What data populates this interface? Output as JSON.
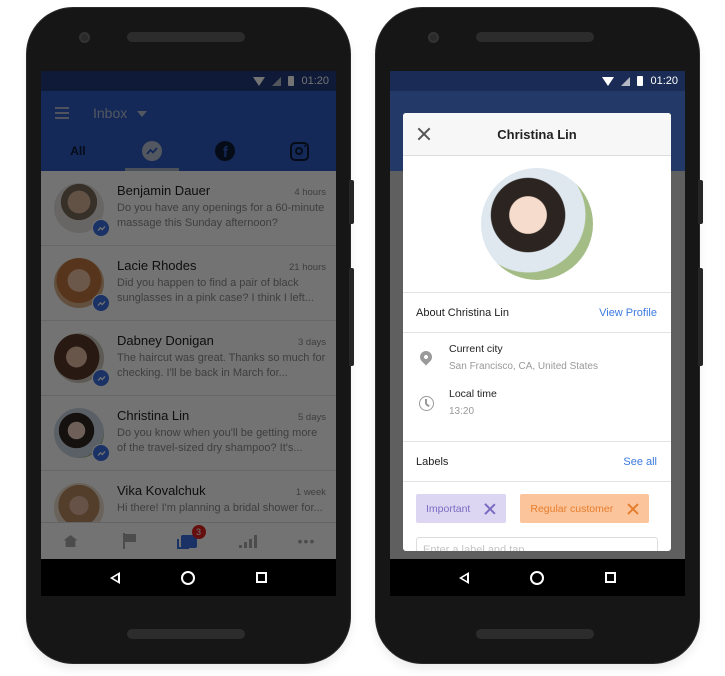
{
  "status_bar": {
    "time": "01:20"
  },
  "left_phone": {
    "app_bar": {
      "title": "Inbox",
      "tabs": [
        {
          "label": "All",
          "icon": ""
        },
        {
          "label": "",
          "icon": "messenger-icon",
          "active": true
        },
        {
          "label": "",
          "icon": "facebook-icon"
        },
        {
          "label": "",
          "icon": "instagram-icon"
        }
      ]
    },
    "conversations": [
      {
        "name": "Benjamin Dauer",
        "time": "4 hours",
        "preview": "Do you have any openings for a 60-minute massage this Sunday afternoon?",
        "source_icon": "messenger-icon"
      },
      {
        "name": "Lacie Rhodes",
        "time": "21 hours",
        "preview": "Did you happen to find a pair of black sunglasses in a pink case? I think I left...",
        "source_icon": "messenger-icon"
      },
      {
        "name": "Dabney Donigan",
        "time": "3 days",
        "preview": "The haircut was great. Thanks so much for checking. I'll be back in March for...",
        "source_icon": "messenger-icon"
      },
      {
        "name": "Christina Lin",
        "time": "5 days",
        "preview": "Do you know when you'll be getting more of the travel-sized dry shampoo? It's...",
        "source_icon": "messenger-icon",
        "highlighted": true
      },
      {
        "name": "Vika Kovalchuk",
        "time": "1 week",
        "preview": "Hi there! I'm planning a bridal shower for...",
        "source_icon": "messenger-icon"
      }
    ],
    "bottom_nav": [
      {
        "icon": "home-icon"
      },
      {
        "icon": "flag-icon"
      },
      {
        "icon": "inbox-chat-icon",
        "badge": "3",
        "active": true
      },
      {
        "icon": "insights-icon"
      },
      {
        "icon": "more-icon"
      }
    ]
  },
  "right_phone": {
    "modal": {
      "title": "Christina Lin",
      "about_title": "About Christina Lin",
      "view_profile": "View Profile",
      "info": [
        {
          "icon": "location-pin-icon",
          "label": "Current city",
          "value": "San Francisco, CA, United States"
        },
        {
          "icon": "clock-icon",
          "label": "Local time",
          "value": "13:20"
        }
      ],
      "labels_title": "Labels",
      "see_all": "See all",
      "labels": [
        {
          "text": "Important",
          "color": "#ddd6f3",
          "text_color": "#7b6cc1"
        },
        {
          "text": "Regular customer",
          "color": "#fbc49b",
          "text_color": "#e67e2e"
        }
      ],
      "label_input_placeholder": "Enter a label and tap"
    }
  },
  "colors": {
    "brand_blue": "#2d5bc0",
    "messenger_blue": "#3b6fe0",
    "link_blue": "#3b7ae0",
    "notification_red": "#e02020"
  }
}
